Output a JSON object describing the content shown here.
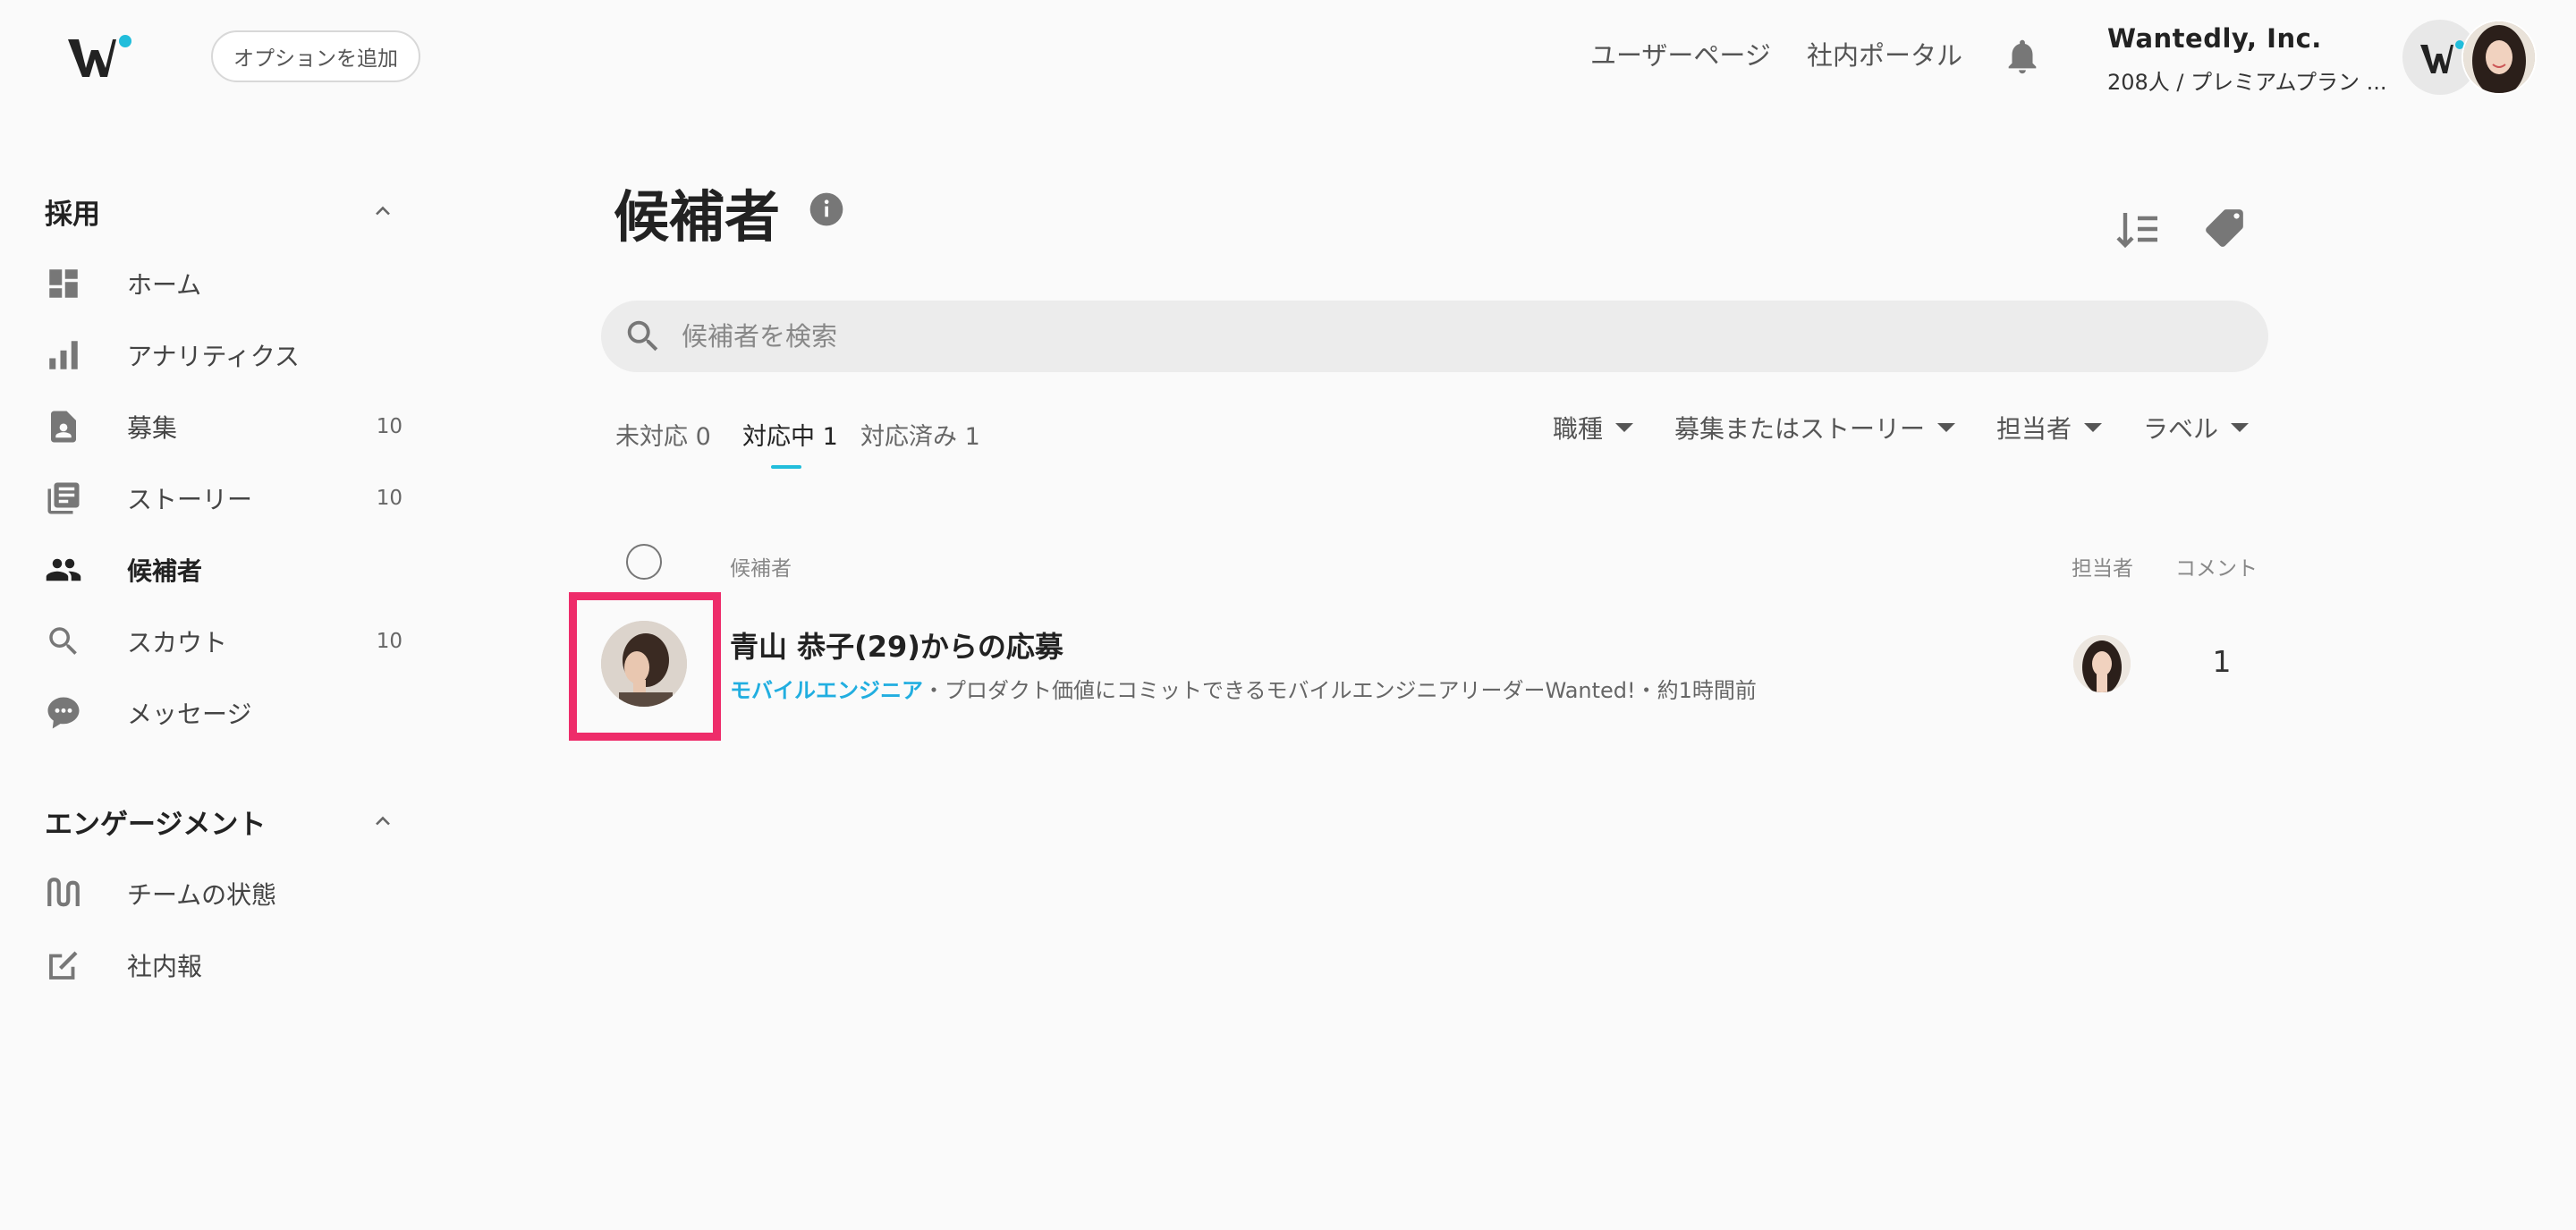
{
  "header": {
    "add_option_label": "オプションを追加",
    "user_page_link": "ユーザーページ",
    "portal_link": "社内ポータル",
    "company_name": "Wantedly, Inc.",
    "company_plan": "208人 / プレミアムプラン ..."
  },
  "sidebar": {
    "recruit_section": "採用",
    "recruit_items": [
      {
        "label": "ホーム",
        "count": ""
      },
      {
        "label": "アナリティクス",
        "count": ""
      },
      {
        "label": "募集",
        "count": "10"
      },
      {
        "label": "ストーリー",
        "count": "10"
      },
      {
        "label": "候補者",
        "count": ""
      },
      {
        "label": "スカウト",
        "count": "10"
      },
      {
        "label": "メッセージ",
        "count": ""
      }
    ],
    "engagement_section": "エンゲージメント",
    "engagement_items": [
      {
        "label": "チームの状態"
      },
      {
        "label": "社内報"
      }
    ]
  },
  "main": {
    "title": "候補者",
    "search_placeholder": "候補者を検索",
    "tabs": [
      {
        "label": "未対応 0"
      },
      {
        "label": "対応中 1"
      },
      {
        "label": "対応済み 1"
      }
    ],
    "filters": [
      "職種",
      "募集またはストーリー",
      "担当者",
      "ラベル"
    ],
    "columns": {
      "candidate": "候補者",
      "assignee": "担当者",
      "comment": "コメント"
    },
    "candidates": [
      {
        "name": "青山 恭子(29)からの応募",
        "job": "モバイルエンジニア",
        "detail": "・プロダクト価値にコミットできるモバイルエンジニアリーダーWanted!・約1時間前",
        "comments": "1"
      }
    ]
  },
  "colors": {
    "accent": "#21bddb",
    "highlight": "#ee2c6a",
    "link": "#21aee0"
  }
}
